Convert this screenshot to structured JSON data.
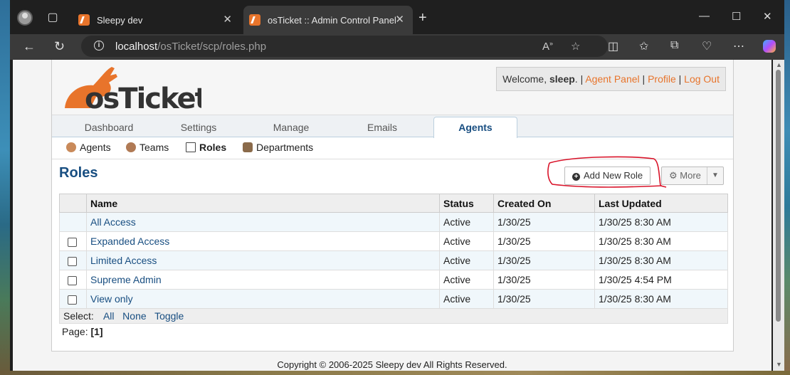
{
  "browser": {
    "tabs": [
      {
        "title": "Sleepy dev",
        "active": false
      },
      {
        "title": "osTicket :: Admin Control Panel",
        "active": true
      }
    ],
    "url_host": "localhost",
    "url_path": "/osTicket/scp/roles.php"
  },
  "header": {
    "welcome_prefix": "Welcome,",
    "username": "sleep",
    "links": [
      "Agent Panel",
      "Profile",
      "Log Out"
    ]
  },
  "tabs": [
    "Dashboard",
    "Settings",
    "Manage",
    "Emails",
    "Agents"
  ],
  "active_tab": "Agents",
  "subnav": [
    {
      "label": "Agents",
      "icon": "agent-icon"
    },
    {
      "label": "Teams",
      "icon": "team-icon"
    },
    {
      "label": "Roles",
      "icon": "roles-icon",
      "active": true
    },
    {
      "label": "Departments",
      "icon": "department-icon"
    }
  ],
  "page": {
    "title": "Roles",
    "add_button": "Add New Role",
    "more_button": "More"
  },
  "table": {
    "headers": [
      "",
      "Name",
      "Status",
      "Created On",
      "Last Updated"
    ],
    "rows": [
      {
        "name": "All Access",
        "status": "Active",
        "created": "1/30/25",
        "updated": "1/30/25 8:30 AM"
      },
      {
        "name": "Expanded Access",
        "status": "Active",
        "created": "1/30/25",
        "updated": "1/30/25 8:30 AM"
      },
      {
        "name": "Limited Access",
        "status": "Active",
        "created": "1/30/25",
        "updated": "1/30/25 8:30 AM"
      },
      {
        "name": "Supreme Admin",
        "status": "Active",
        "created": "1/30/25",
        "updated": "1/30/25 4:54 PM"
      },
      {
        "name": "View only",
        "status": "Active",
        "created": "1/30/25",
        "updated": "1/30/25 8:30 AM"
      }
    ],
    "select_label": "Select:",
    "select_links": [
      "All",
      "None",
      "Toggle"
    ]
  },
  "pager": {
    "label": "Page:",
    "current": "[1]"
  },
  "footer": "Copyright © 2006-2025 Sleepy dev All Rights Reserved.",
  "colors": {
    "accent": "#e8742b",
    "link": "#184e81",
    "annotation": "#d9142a"
  }
}
